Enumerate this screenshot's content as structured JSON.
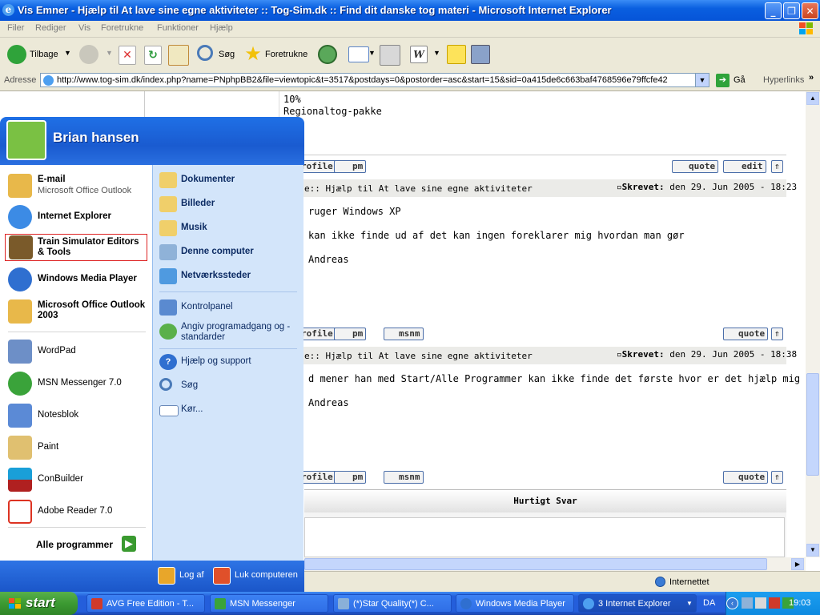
{
  "window": {
    "title": "Vis Emner - Hjælp til At lave sine egne aktiviteter :: Tog-Sim.dk :: Find dit danske tog materi - Microsoft Internet Explorer",
    "minimize": "_",
    "maximize": "❐",
    "close": "✕"
  },
  "menubar": [
    "Filer",
    "Rediger",
    "Vis",
    "Foretrukne",
    "Funktioner",
    "Hjælp"
  ],
  "toolbar": {
    "back": "Tilbage",
    "search": "Søg",
    "favorites": "Foretrukne"
  },
  "address": {
    "label": "Adresse",
    "url": "http://www.tog-sim.dk/index.php?name=PNphpBB2&file=viewtopic&t=3517&postdays=0&postorder=asc&start=15&sid=0a415de6c663baf4768596e79ffcfe42",
    "go": "Gå",
    "links": "Hyperlinks"
  },
  "content": {
    "post0_lines": [
      "10%",
      "Regionaltog-pakke"
    ],
    "buttons": {
      "profile": "rofile",
      "pm": "pm",
      "msnm": "msnm",
      "quote": "quote",
      "edit": "edit",
      "top": "⇑"
    },
    "post1": {
      "subject": "e:: Hjælp til At lave sine egne aktiviteter",
      "written_label": "Skrevet:",
      "date": "den 29. Jun 2005 - 18:23",
      "lines": [
        "ruger Windows XP",
        "kan ikke finde ud af det kan ingen foreklarer mig hvordan man gør",
        "Andreas"
      ]
    },
    "post2": {
      "subject": "e:: Hjælp til At lave sine egne aktiviteter",
      "written_label": "Skrevet:",
      "date": "den 29. Jun 2005 - 18:38",
      "lines": [
        "d mener han med Start/Alle Programmer kan ikke finde det første hvor er det hjælp mig",
        "Andreas"
      ]
    },
    "quick_reply": "Hurtigt Svar"
  },
  "status": {
    "zone": "Internettet"
  },
  "startmenu": {
    "user": "Brian hansen",
    "left": [
      {
        "label": "E-mail",
        "sub": "Microsoft Office Outlook"
      },
      {
        "label": "Internet Explorer"
      },
      {
        "label": "Train Simulator Editors & Tools"
      },
      {
        "label": "Windows Media Player"
      },
      {
        "label": "Microsoft Office Outlook 2003"
      },
      {
        "label": "WordPad"
      },
      {
        "label": "MSN Messenger 7.0"
      },
      {
        "label": "Notesblok"
      },
      {
        "label": "Paint"
      },
      {
        "label": "ConBuilder"
      },
      {
        "label": "Adobe Reader 7.0"
      }
    ],
    "all_programs": "Alle programmer",
    "right": [
      {
        "label": "Dokumenter"
      },
      {
        "label": "Billeder"
      },
      {
        "label": "Musik"
      },
      {
        "label": "Denne computer"
      },
      {
        "label": "Netværkssteder"
      },
      {
        "label": "Kontrolpanel"
      },
      {
        "label": "Angiv programadgang og -standarder"
      },
      {
        "label": "Hjælp og support"
      },
      {
        "label": "Søg"
      },
      {
        "label": "Kør..."
      }
    ],
    "logoff": "Log af",
    "shutdown": "Luk computeren"
  },
  "taskbar": {
    "start": "start",
    "tasks": [
      "AVG Free Edition - T...",
      "MSN Messenger",
      "(*)Star Quality(*) C...",
      "Windows Media Player",
      "3 Internet Explorer"
    ],
    "lang": "DA",
    "clock": "19:03"
  }
}
